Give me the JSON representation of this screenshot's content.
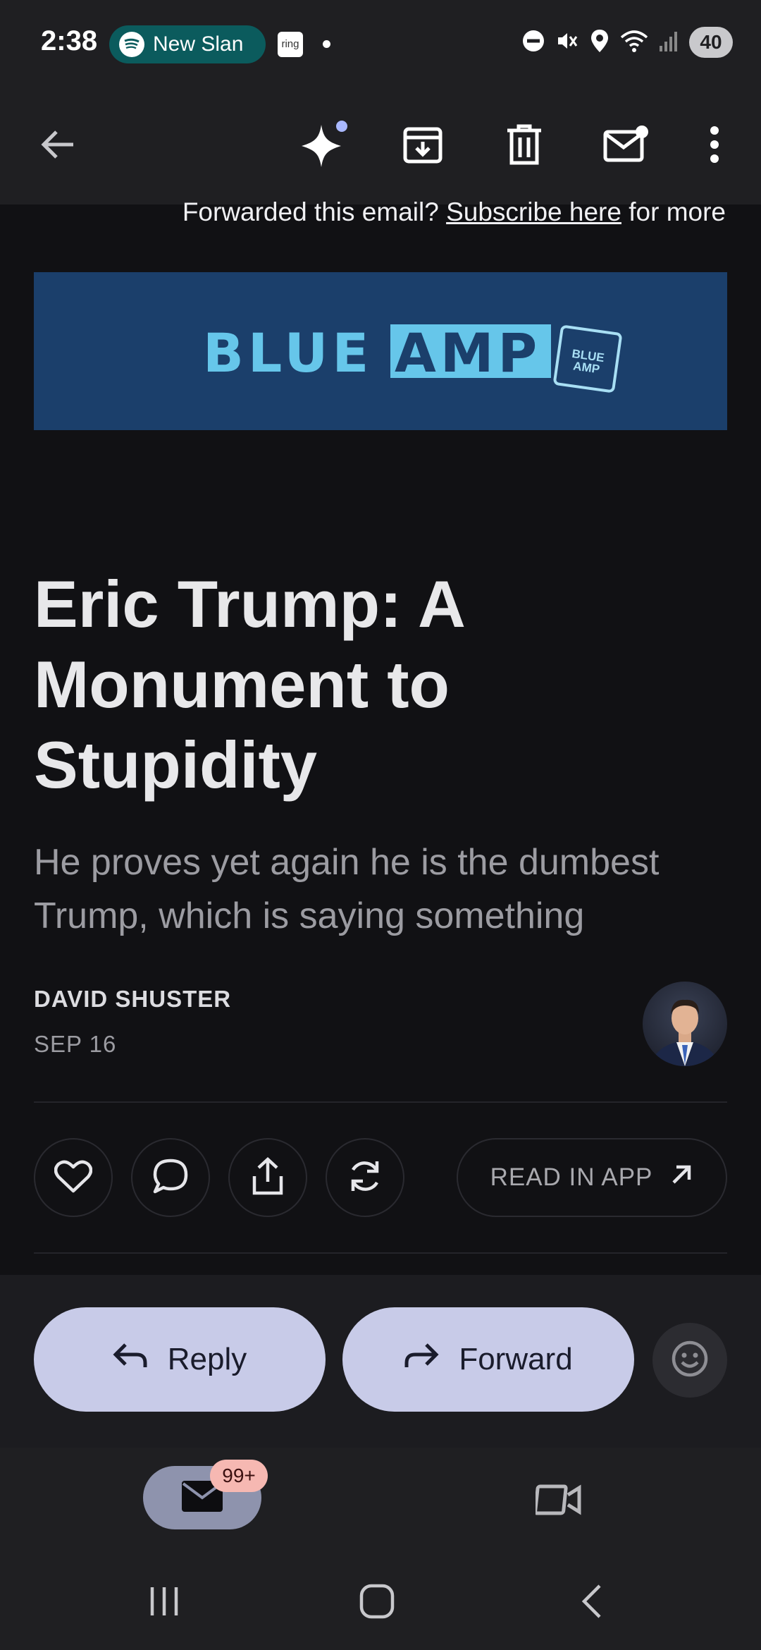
{
  "status_bar": {
    "time": "2:38",
    "spotify_text": "New Slan",
    "ring_label": "ring",
    "battery": "40"
  },
  "toolbar": {
    "icons": [
      "back-arrow-icon",
      "gemini-sparkle-icon",
      "archive-icon",
      "delete-icon",
      "mark-unread-icon",
      "more-vert-icon"
    ]
  },
  "email": {
    "forward_prefix": "Forwarded this email? ",
    "forward_link": "Subscribe here",
    "forward_suffix": " for more",
    "banner": {
      "word1": "BLUE",
      "word2": "AMP",
      "badge_line1": "BLUE",
      "badge_line2": "AMP"
    },
    "title": "Eric Trump: A Monument to Stupidity",
    "subtitle": "He proves yet again he is the dumbest Trump, which is saying something",
    "author": "DAVID SHUSTER",
    "date": "SEP 16",
    "read_in_app": "READ IN APP"
  },
  "actions": {
    "reply": "Reply",
    "forward": "Forward"
  },
  "bottom_nav": {
    "mail_badge": "99+"
  },
  "colors": {
    "accent_pill": "#c8cbe8",
    "banner_bg": "#1b3f6b",
    "banner_text": "#66c6ea",
    "spotify_pill": "#0b5b5d",
    "badge": "#f6b8b2"
  }
}
